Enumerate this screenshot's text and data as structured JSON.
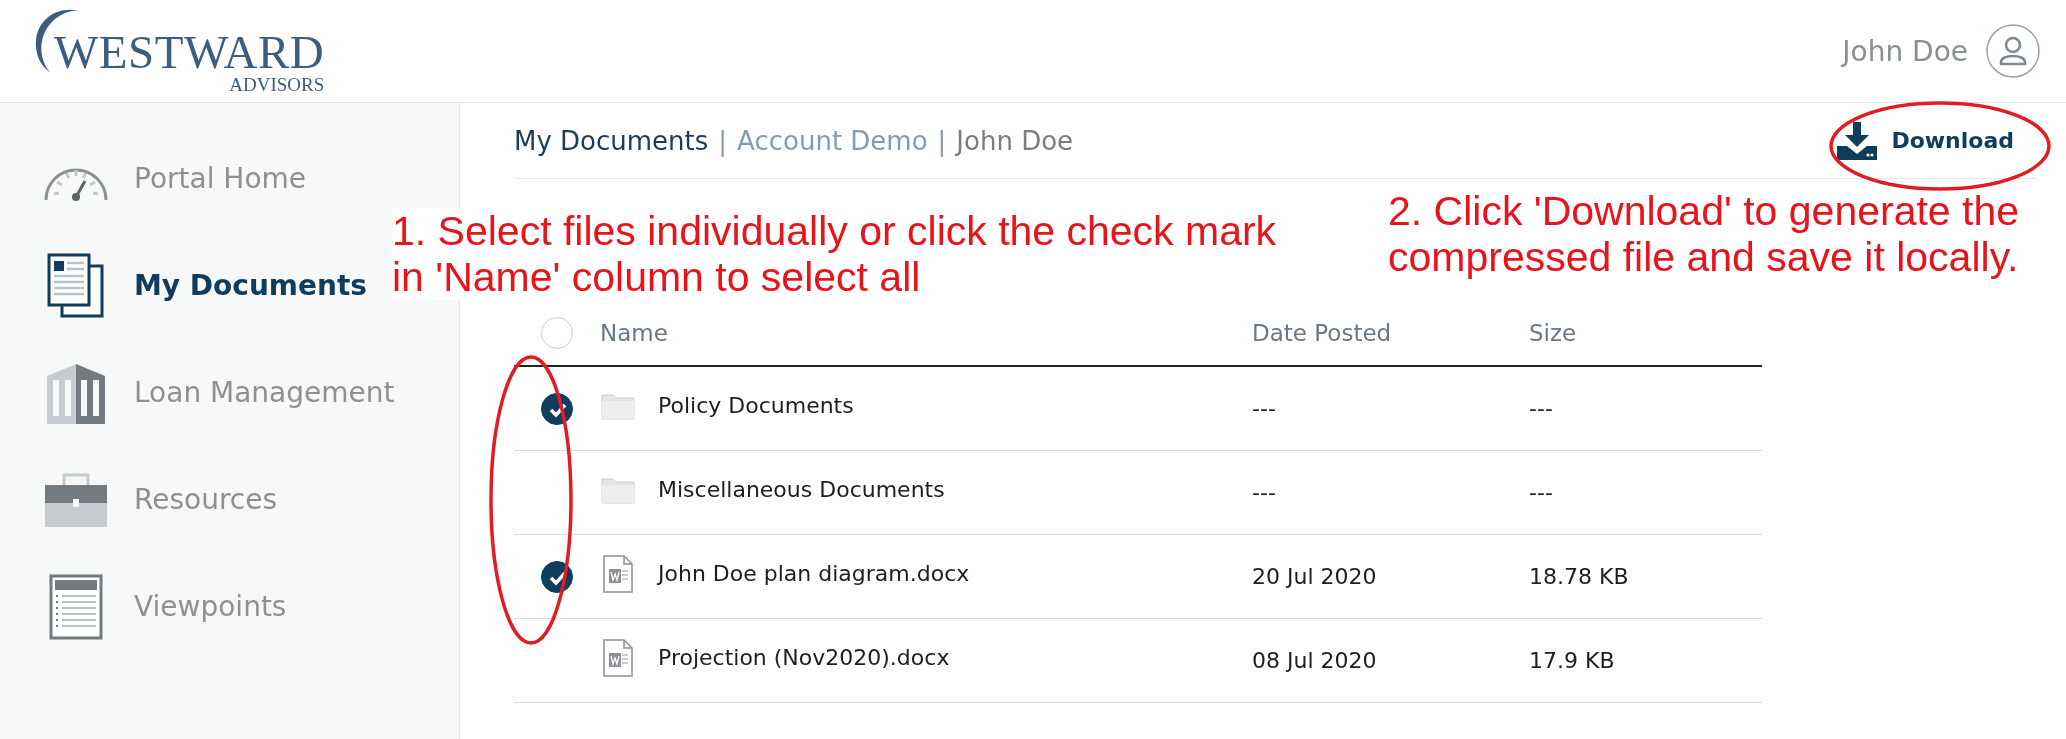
{
  "logo": {
    "name": "WESTWARD",
    "tagline": "ADVISORS"
  },
  "user": {
    "name": "John Doe"
  },
  "sidebar": {
    "items": [
      {
        "label": "Portal Home",
        "kind": "gauge",
        "selected": false
      },
      {
        "label": "My Documents",
        "kind": "documents",
        "selected": true
      },
      {
        "label": "Loan Management",
        "kind": "bank",
        "selected": false
      },
      {
        "label": "Resources",
        "kind": "briefcase",
        "selected": false
      },
      {
        "label": "Viewpoints",
        "kind": "newspaper",
        "selected": false
      }
    ]
  },
  "breadcrumb": [
    {
      "label": "My Documents",
      "kind": "current"
    },
    {
      "label": "Account Demo",
      "kind": "link",
      "separator": "|"
    },
    {
      "label": "John Doe",
      "kind": "plain",
      "separator": "|"
    }
  ],
  "download_button": {
    "label": "Download"
  },
  "table": {
    "select_all": {
      "checked": false
    },
    "columns": [
      "Name",
      "Date Posted",
      "Size"
    ],
    "rows": [
      {
        "kind": "folder",
        "name": "Policy Documents",
        "date": "---",
        "size": "---",
        "checked": true
      },
      {
        "kind": "folder",
        "name": "Miscellaneous Documents",
        "date": "---",
        "size": "---",
        "checked": false
      },
      {
        "kind": "word",
        "name": "John Doe plan diagram.docx",
        "date": "20 Jul 2020",
        "size": "18.78 KB",
        "checked": true
      },
      {
        "kind": "word",
        "name": "Projection (Nov2020).docx",
        "date": "08 Jul 2020",
        "size": "17.9 KB",
        "checked": false
      }
    ]
  },
  "annotations": [
    {
      "kind": "left",
      "text": "1. Select files individually or click the check mark in 'Name' column to select all"
    },
    {
      "kind": "right",
      "text": "2. Click 'Download' to generate the compressed file and save it locally."
    }
  ]
}
